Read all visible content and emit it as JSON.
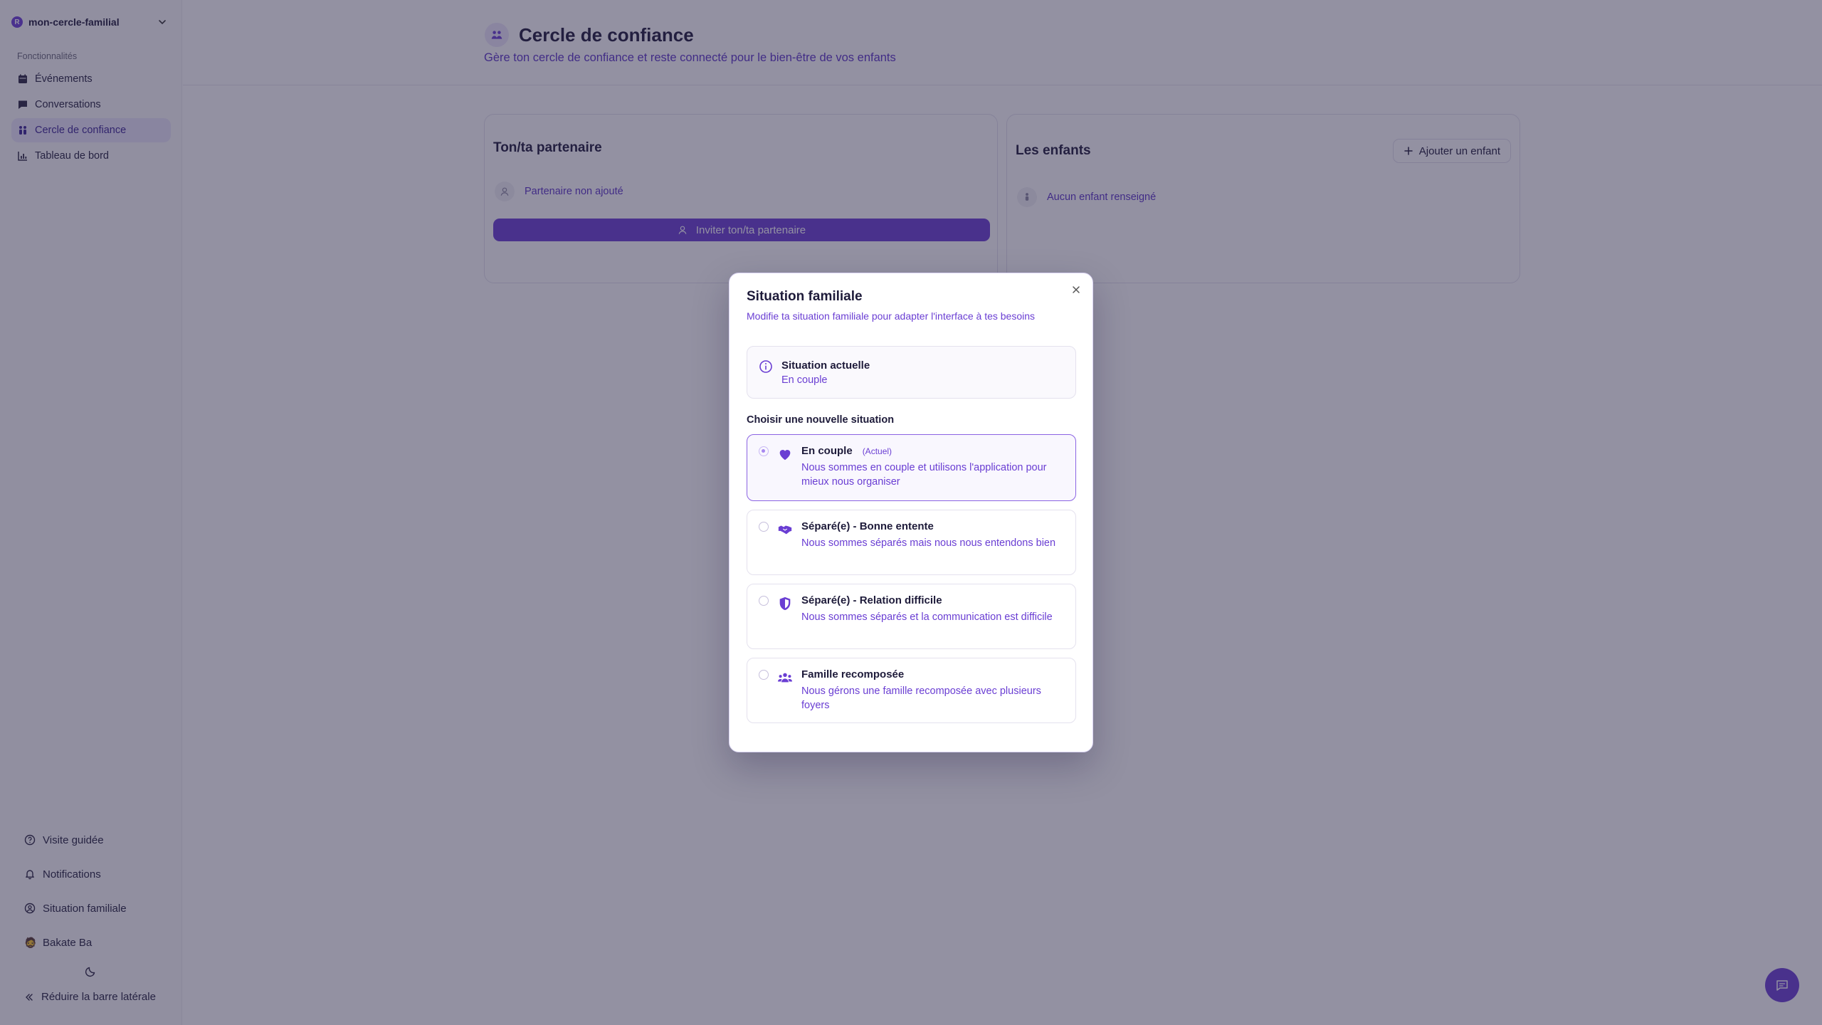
{
  "sidebar": {
    "workspace": {
      "initial": "R",
      "name": "mon-cercle-familial"
    },
    "section_label": "Fonctionnalités",
    "items": [
      {
        "label": "Événements",
        "icon": "calendar-icon"
      },
      {
        "label": "Conversations",
        "icon": "chat-icon"
      },
      {
        "label": "Cercle de confiance",
        "icon": "people-icon",
        "active": true
      },
      {
        "label": "Tableau de bord",
        "icon": "bar-chart-icon"
      }
    ],
    "bottom": {
      "guided_tour": "Visite guidée",
      "notifications": "Notifications",
      "family_situation": "Situation familiale",
      "user_name": "Bakate Ba",
      "user_avatar": "🧔",
      "collapse": "Réduire la barre latérale"
    }
  },
  "page": {
    "title": "Cercle de confiance",
    "subtitle": "Gère ton cercle de confiance et reste connecté pour le bien-être de vos enfants"
  },
  "partner_card": {
    "title": "Ton/ta partenaire",
    "empty": "Partenaire non ajouté",
    "invite_button": "Inviter ton/ta partenaire"
  },
  "children_card": {
    "title": "Les enfants",
    "add_button": "Ajouter un enfant",
    "empty": "Aucun enfant renseigné"
  },
  "dialog": {
    "title": "Situation familiale",
    "description": "Modifie ta situation familiale pour adapter l'interface à tes besoins",
    "current_label": "Situation actuelle",
    "current_value": "En couple",
    "choose_label": "Choisir une nouvelle situation",
    "options": [
      {
        "title": "En couple",
        "badge": "(Actuel)",
        "description": "Nous sommes en couple et utilisons l'application pour mieux nous organiser",
        "icon": "heart-icon",
        "selected": true
      },
      {
        "title": "Séparé(e) - Bonne entente",
        "badge": "",
        "description": "Nous sommes séparés mais nous nous entendons bien",
        "icon": "handshake-icon",
        "selected": false
      },
      {
        "title": "Séparé(e) - Relation difficile",
        "badge": "",
        "description": "Nous sommes séparés et la communication est difficile",
        "icon": "shield-icon",
        "selected": false
      },
      {
        "title": "Famille recomposée",
        "badge": "",
        "description": "Nous gérons une famille recomposée avec plusieurs foyers",
        "icon": "group-icon",
        "selected": false
      }
    ]
  },
  "colors": {
    "accent": "#6a3ed3",
    "overlay": "rgba(40,36,70,0.5)",
    "sidebar_active_bg": "#ebe6fa"
  }
}
